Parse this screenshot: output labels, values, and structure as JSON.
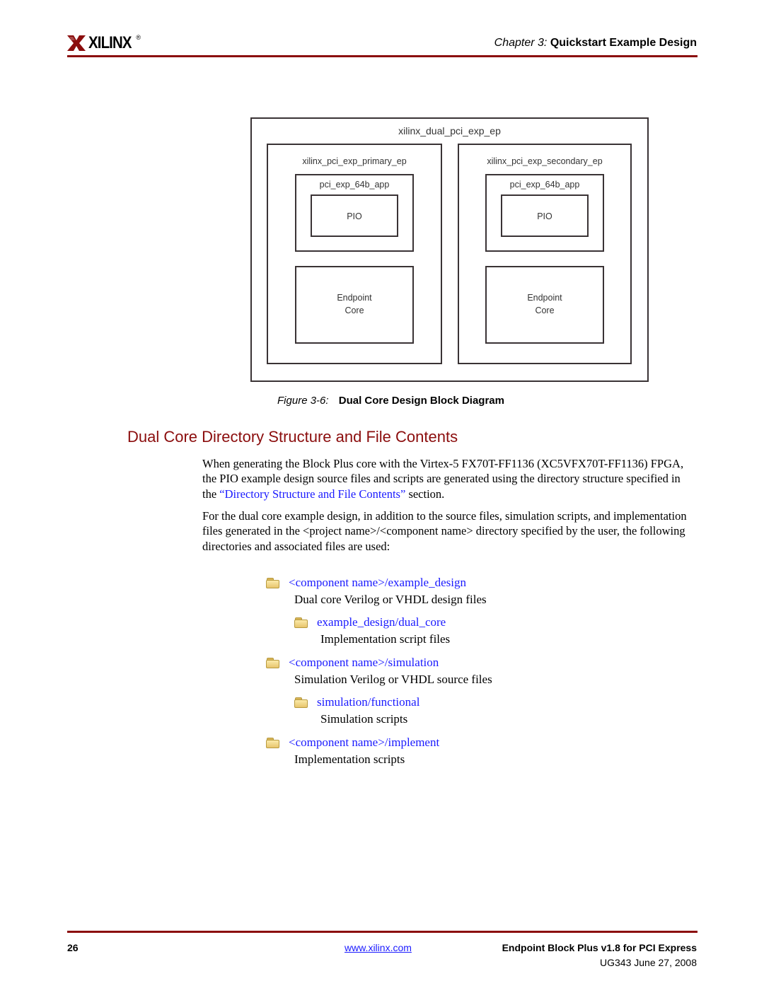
{
  "header": {
    "logo_text": "XILINX",
    "logo_registered": "®",
    "chapter_label": "Chapter 3:",
    "chapter_title": "Quickstart Example Design",
    "brand_color": "#8b0d0d"
  },
  "diagram": {
    "outer_label": "xilinx_dual_pci_exp_ep",
    "primary": {
      "label": "xilinx_pci_exp_primary_ep",
      "app_label": "pci_exp_64b_app",
      "pio_label": "PIO",
      "core_label_line1": "Endpoint",
      "core_label_line2": "Core"
    },
    "secondary": {
      "label": "xilinx_pci_exp_secondary_ep",
      "app_label": "pci_exp_64b_app",
      "pio_label": "PIO",
      "core_label_line1": "Endpoint",
      "core_label_line2": "Core"
    }
  },
  "figure": {
    "number": "Figure 3-6:",
    "title": "Dual Core Design Block Diagram"
  },
  "section": {
    "heading": "Dual Core Directory Structure and File Contents",
    "para1_before": "When generating the Block Plus core with the Virtex-5 FX70T-FF1136 (XC5VFX70T-FF1136) FPGA, the PIO example design source files and scripts are generated using the directory structure specified in the ",
    "para1_link": "“Directory Structure and File Contents”",
    "para1_after": " section.",
    "para2": "For the dual core example design, in addition to the source files, simulation scripts, and implementation files generated in the <project name>/<component name> directory specified by the user, the following directories and associated files are used:"
  },
  "directories": [
    {
      "name": "<component name>/example_design",
      "desc": "Dual core Verilog or VHDL design files",
      "icon": "folder-icon"
    },
    {
      "name": "example_design/dual_core",
      "desc": "Implementation script files",
      "icon": "folder-icon"
    },
    {
      "name": "<component name>/simulation",
      "desc": "Simulation Verilog or VHDL source files",
      "icon": "folder-icon"
    },
    {
      "name": "simulation/functional",
      "desc": "Simulation scripts",
      "icon": "folder-icon"
    },
    {
      "name": "<component name>/implement",
      "desc": "Implementation scripts",
      "icon": "folder-icon"
    }
  ],
  "footer": {
    "page_number": "26",
    "website": "www.xilinx.com",
    "doc_title": "Endpoint Block Plus v1.8 for PCI Express",
    "doc_id_date": "UG343 June 27, 2008"
  }
}
